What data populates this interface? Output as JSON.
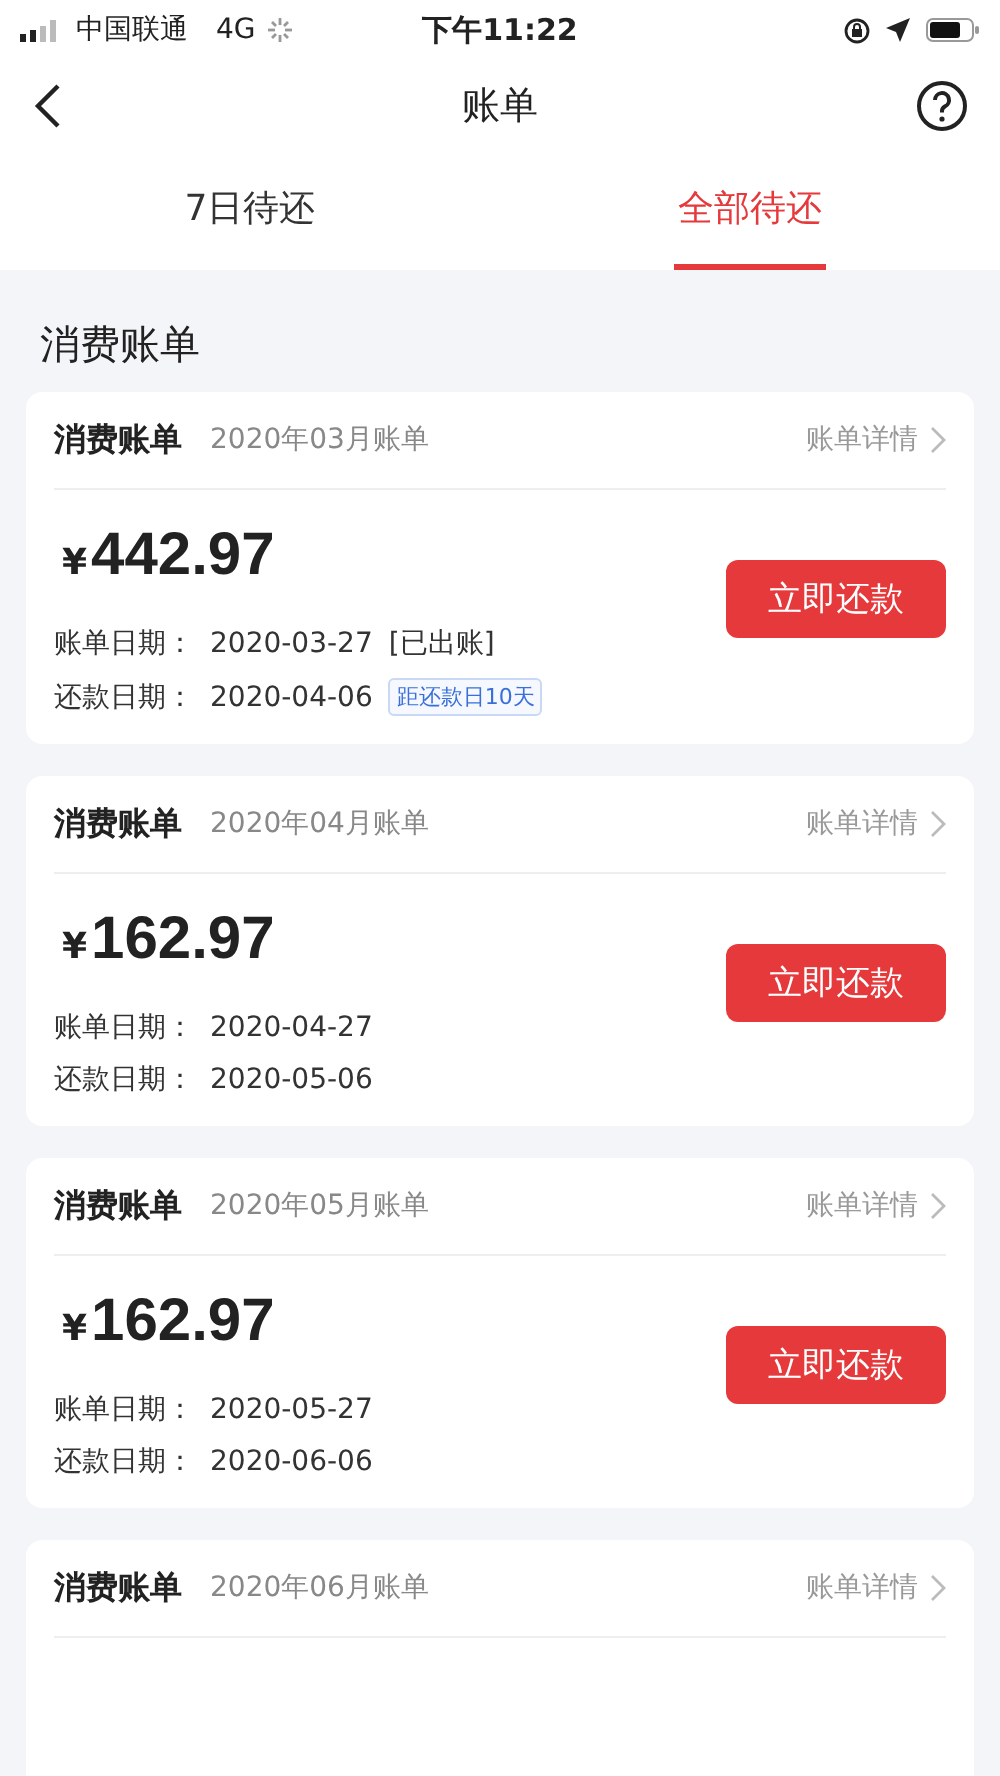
{
  "status_bar": {
    "carrier": "中国联通",
    "network": "4G",
    "time": "下午11:22"
  },
  "nav": {
    "title": "账单"
  },
  "tabs": [
    {
      "label": "7日待还",
      "selected": false
    },
    {
      "label": "全部待还",
      "selected": true
    }
  ],
  "section_title": "消费账单",
  "bills": [
    {
      "title": "消费账单",
      "period": "2020年03月账单",
      "detail_link": "账单详情",
      "currency": "¥",
      "amount": "442.97",
      "bill_date_label": "账单日期：",
      "bill_date": "2020-03-27",
      "bill_status": "[已出账]",
      "due_date_label": "还款日期：",
      "due_date": "2020-04-06",
      "due_badge": "距还款日10天",
      "pay_button": "立即还款"
    },
    {
      "title": "消费账单",
      "period": "2020年04月账单",
      "detail_link": "账单详情",
      "currency": "¥",
      "amount": "162.97",
      "bill_date_label": "账单日期：",
      "bill_date": "2020-04-27",
      "due_date_label": "还款日期：",
      "due_date": "2020-05-06",
      "pay_button": "立即还款"
    },
    {
      "title": "消费账单",
      "period": "2020年05月账单",
      "detail_link": "账单详情",
      "currency": "¥",
      "amount": "162.97",
      "bill_date_label": "账单日期：",
      "bill_date": "2020-05-27",
      "due_date_label": "还款日期：",
      "due_date": "2020-06-06",
      "pay_button": "立即还款"
    },
    {
      "title": "消费账单",
      "period": "2020年06月账单",
      "detail_link": "账单详情"
    }
  ]
}
